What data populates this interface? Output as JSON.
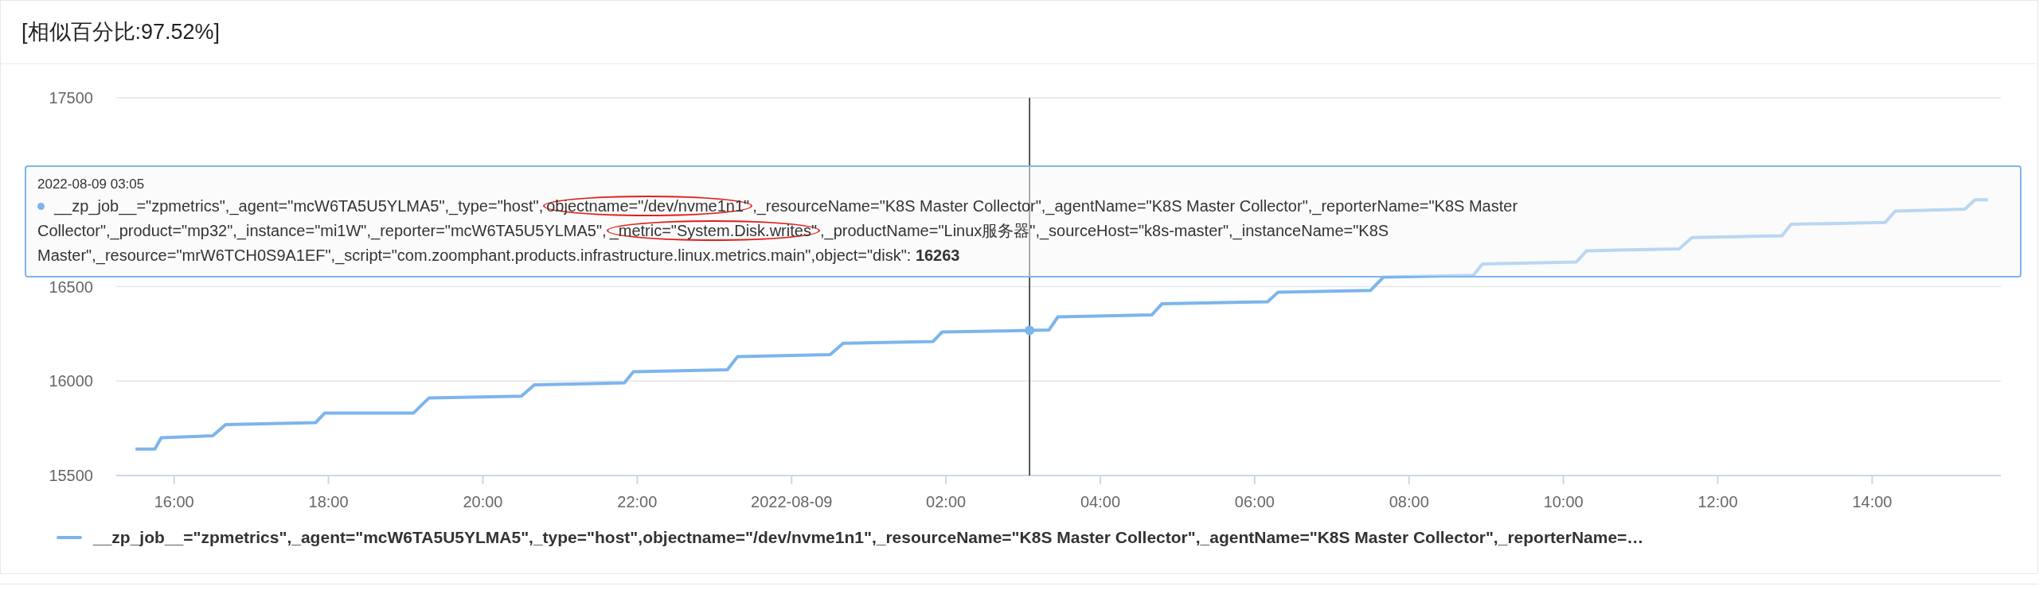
{
  "title": "[相似百分比:97.52%]",
  "chart": {
    "chart_data": {
      "type": "line",
      "x": [
        "2022-08-08T15:30",
        "2022-08-08T15:45",
        "2022-08-08T15:50",
        "2022-08-08T16:30",
        "2022-08-08T16:40",
        "2022-08-08T17:50",
        "2022-08-08T17:57",
        "2022-08-08T19:06",
        "2022-08-08T19:18",
        "2022-08-08T20:30",
        "2022-08-08T20:40",
        "2022-08-08T21:50",
        "2022-08-08T21:57",
        "2022-08-08T23:10",
        "2022-08-08T23:18",
        "2022-08-09T00:30",
        "2022-08-09T00:40",
        "2022-08-09T01:50",
        "2022-08-09T01:57",
        "2022-08-09T03:20",
        "2022-08-09T03:27",
        "2022-08-09T04:40",
        "2022-08-09T04:48",
        "2022-08-09T06:10",
        "2022-08-09T06:18",
        "2022-08-09T07:30",
        "2022-08-09T07:40",
        "2022-08-09T08:50",
        "2022-08-09T08:57",
        "2022-08-09T10:10",
        "2022-08-09T10:18",
        "2022-08-09T11:30",
        "2022-08-09T11:40",
        "2022-08-09T12:50",
        "2022-08-09T12:57",
        "2022-08-09T14:10",
        "2022-08-09T14:18",
        "2022-08-09T15:12",
        "2022-08-09T15:20",
        "2022-08-09T15:30"
      ],
      "series": [
        {
          "name": "__zp_job__=\"zpmetrics\",_agent=\"mcW6TA5U5YLMA5\",_type=\"host\",objectname=\"/dev/nvme1n1\",_resourceName=\"K8S Master Collector\",_agentName=\"K8S Master Collector\",_reporterName=…",
          "color": "#7cb5ec",
          "values": [
            15640,
            15640,
            15700,
            15710,
            15770,
            15780,
            15830,
            15830,
            15910,
            15920,
            15980,
            15990,
            16050,
            16060,
            16130,
            16140,
            16200,
            16210,
            16260,
            16270,
            16340,
            16350,
            16410,
            16420,
            16470,
            16480,
            16550,
            16560,
            16620,
            16630,
            16690,
            16700,
            16760,
            16770,
            16830,
            16840,
            16900,
            16910,
            16960,
            16960
          ]
        }
      ],
      "xlim": [
        "2022-08-08T15:15",
        "2022-08-09T15:40"
      ],
      "ylim": [
        15500,
        17500
      ],
      "xticks": [
        {
          "value": "2022-08-08T16:00",
          "label": "16:00"
        },
        {
          "value": "2022-08-08T18:00",
          "label": "18:00"
        },
        {
          "value": "2022-08-08T20:00",
          "label": "20:00"
        },
        {
          "value": "2022-08-08T22:00",
          "label": "22:00"
        },
        {
          "value": "2022-08-09T00:00",
          "label": "2022-08-09"
        },
        {
          "value": "2022-08-09T02:00",
          "label": "02:00"
        },
        {
          "value": "2022-08-09T04:00",
          "label": "04:00"
        },
        {
          "value": "2022-08-09T06:00",
          "label": "06:00"
        },
        {
          "value": "2022-08-09T08:00",
          "label": "08:00"
        },
        {
          "value": "2022-08-09T10:00",
          "label": "10:00"
        },
        {
          "value": "2022-08-09T12:00",
          "label": "12:00"
        },
        {
          "value": "2022-08-09T14:00",
          "label": "14:00"
        }
      ],
      "yticks": [
        15500,
        16000,
        16500,
        17500
      ],
      "ref_lines": [
        {
          "axis": "x",
          "value": "2022-08-09T03:05",
          "color": "#222222"
        }
      ]
    },
    "tooltip": {
      "date": "2022-08-09 03:05",
      "color": "#7cb5ec",
      "segments": [
        {
          "text": "__zp_job__=\"zpmetrics\",_agent=\"mcW6TA5U5YLMA5\",_type=\"host\",",
          "highlighted": false
        },
        {
          "text": "objectname=\"/dev/nvme1n1\"",
          "highlighted": true
        },
        {
          "text": ",_resourceName=\"K8S Master Collector\",_agentName=\"K8S Master Collector\",_reporterName=\"K8S Master Collector\",_product=\"mp32\",_instance=\"mi1W\",_reporter=\"mcW6TA5U5YLMA5\",",
          "highlighted": false
        },
        {
          "text": "_metric=\"System.Disk.writes\"",
          "highlighted": true
        },
        {
          "text": ",_productName=\"Linux服务器\",_sourceHost=\"k8s-master\",_instanceName=\"K8S Master\",_resource=\"mrW6TCH0S9A1EF\",_script=\"com.zoomphant.products.infrastructure.linux.metrics.main\",object=\"disk\": ",
          "highlighted": false
        }
      ],
      "value": "16263"
    }
  }
}
